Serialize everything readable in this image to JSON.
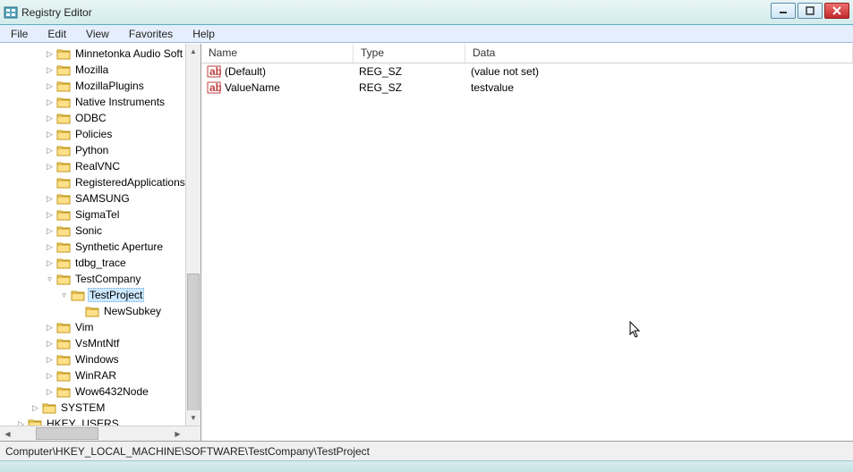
{
  "window": {
    "title": "Registry Editor"
  },
  "menu": {
    "items": [
      "File",
      "Edit",
      "View",
      "Favorites",
      "Help"
    ]
  },
  "tree": {
    "items": [
      {
        "depth": 3,
        "exp": "▷",
        "label": "Minnetonka Audio Soft"
      },
      {
        "depth": 3,
        "exp": "▷",
        "label": "Mozilla"
      },
      {
        "depth": 3,
        "exp": "▷",
        "label": "MozillaPlugins"
      },
      {
        "depth": 3,
        "exp": "▷",
        "label": "Native Instruments"
      },
      {
        "depth": 3,
        "exp": "▷",
        "label": "ODBC"
      },
      {
        "depth": 3,
        "exp": "▷",
        "label": "Policies"
      },
      {
        "depth": 3,
        "exp": "▷",
        "label": "Python"
      },
      {
        "depth": 3,
        "exp": "▷",
        "label": "RealVNC"
      },
      {
        "depth": 3,
        "exp": "",
        "label": "RegisteredApplications"
      },
      {
        "depth": 3,
        "exp": "▷",
        "label": "SAMSUNG"
      },
      {
        "depth": 3,
        "exp": "▷",
        "label": "SigmaTel"
      },
      {
        "depth": 3,
        "exp": "▷",
        "label": "Sonic"
      },
      {
        "depth": 3,
        "exp": "▷",
        "label": "Synthetic Aperture"
      },
      {
        "depth": 3,
        "exp": "▷",
        "label": "tdbg_trace"
      },
      {
        "depth": 3,
        "exp": "▿",
        "label": "TestCompany"
      },
      {
        "depth": 4,
        "exp": "▿",
        "label": "TestProject",
        "selected": true
      },
      {
        "depth": 5,
        "exp": "",
        "label": "NewSubkey"
      },
      {
        "depth": 3,
        "exp": "▷",
        "label": "Vim"
      },
      {
        "depth": 3,
        "exp": "▷",
        "label": "VsMntNtf"
      },
      {
        "depth": 3,
        "exp": "▷",
        "label": "Windows"
      },
      {
        "depth": 3,
        "exp": "▷",
        "label": "WinRAR"
      },
      {
        "depth": 3,
        "exp": "▷",
        "label": "Wow6432Node"
      },
      {
        "depth": 2,
        "exp": "▷",
        "label": "SYSTEM"
      },
      {
        "depth": 1,
        "exp": "▷",
        "label": "HKEY_USERS"
      }
    ]
  },
  "list": {
    "columns": {
      "name": "Name",
      "type": "Type",
      "data": "Data"
    },
    "rows": [
      {
        "name": "(Default)",
        "type": "REG_SZ",
        "data": "(value not set)"
      },
      {
        "name": "ValueName",
        "type": "REG_SZ",
        "data": "testvalue"
      }
    ]
  },
  "statusbar": {
    "path": "Computer\\HKEY_LOCAL_MACHINE\\SOFTWARE\\TestCompany\\TestProject"
  }
}
